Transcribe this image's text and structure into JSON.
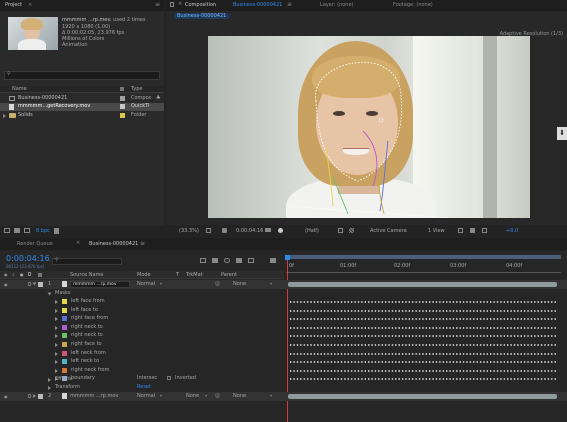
{
  "project": {
    "tab_label": "Project",
    "footage_name": "mmmmm ...rp.mov",
    "footage_used": ", used 2 times",
    "info_line1": "1920 x 1080 (1.00)",
    "info_line2": "Δ 0:00:02:05, 23.976 fps",
    "info_line3": "Millions of Colors",
    "info_line4": "Animation",
    "search_placeholder": "",
    "col_name": "Name",
    "col_type": "Type",
    "items": [
      {
        "name": "Business-00000421",
        "type": "Compos"
      },
      {
        "name": "mmmmm...getRecovery.mov",
        "type": "QuickTi"
      },
      {
        "name": "Solids",
        "type": "Folder"
      }
    ],
    "bpc": "8 bpc"
  },
  "comp": {
    "tab_label": "Composition",
    "tab_name": "Business-00000421",
    "layer_tab": "Layer: (none)",
    "footage_tab": "Footage: (none)",
    "subtab": "Business-00000421",
    "active_camera_label": "Active Camera",
    "renderer_label": "Adaptive Resolution (1/3)",
    "zoom": "(33.3%)",
    "timecode": "0:00:04:16",
    "resolution": "(Half)",
    "view_camera": "Active Camera",
    "view_count": "1 View",
    "offset": "+0.0"
  },
  "timeline": {
    "tab_render": "Render Queue",
    "tab_comp": "Business-00000421",
    "timecode": "0:00:04:16",
    "frame_sub": "00112 (23.976 fps)",
    "search_placeholder": "",
    "col_source": "Source Name",
    "col_mode": "Mode",
    "col_t": "T",
    "col_trkmat": "TrkMat",
    "col_parent": "Parent",
    "ruler": [
      "0f",
      "01:00f",
      "02:00f",
      "03:00f",
      "04:00f"
    ],
    "layer1": {
      "num": "1",
      "name": "mmmmm ...rp.mov",
      "mode": "Normal",
      "parent": "None"
    },
    "masks_label": "Masks",
    "masks": [
      {
        "name": "left face from",
        "color": "#e5d64a"
      },
      {
        "name": "left face to",
        "color": "#e5d64a"
      },
      {
        "name": "right face from",
        "color": "#5a6fd8"
      },
      {
        "name": "right neck to",
        "color": "#b45ad0"
      },
      {
        "name": "right neck to",
        "color": "#6bc06b"
      },
      {
        "name": "right face to",
        "color": "#c9a64a"
      },
      {
        "name": "left neck from",
        "color": "#d0557a"
      },
      {
        "name": "left neck to",
        "color": "#4fb5c9"
      },
      {
        "name": "right neck from",
        "color": "#d07a3a"
      },
      {
        "name": "boundary",
        "color": "#8ca9d0"
      }
    ],
    "boundary_mode": "Intersec",
    "boundary_inverted": "Inverted",
    "effects_label": "Effects",
    "transform_label": "Transform",
    "transform_reset": "Reset",
    "layer2": {
      "num": "2",
      "name": "mmmmm ...rp.mov",
      "mode": "Normal",
      "trkmat": "None",
      "parent": "None"
    }
  }
}
